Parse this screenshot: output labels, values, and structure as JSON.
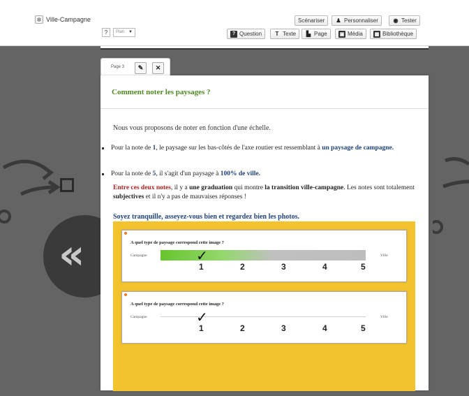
{
  "toolbar": {
    "project_name": "Ville-Campagne",
    "help_label": "?",
    "select_value": "Plan",
    "buttons_top": [
      "Scénariser",
      "Personnaliser",
      "Tester"
    ],
    "buttons_bottom": [
      "Question",
      "Texte",
      "Page",
      "Média",
      "Bibliothèque"
    ]
  },
  "tab": {
    "label": "Page 3",
    "edit_icon": "pencil-icon",
    "close_icon": "close-icon"
  },
  "page": {
    "title": "Comment noter les paysages ?",
    "intro": "Nous vous proposons de noter en fonction d'une échelle.",
    "bullet1_a": "Pour la note de ",
    "bullet1_num": "1",
    "bullet1_b": ", le paysage sur les bas-côtés de l'axe routier est ressemblant à ",
    "bullet1_c": "un paysage de campagne.",
    "bullet2_a": "Pour la note de ",
    "bullet2_num": "5",
    "bullet2_b": ", il s'agit d'un paysage à ",
    "bullet2_c": "100% de ville.",
    "para_a": "Entre ces deux notes",
    "para_b": ", il y a ",
    "para_c": "une graduation",
    "para_d": " qui montre ",
    "para_e": "la transition ville-campagne",
    "para_f": ". Les notes sont totalement ",
    "para_g": "subjectives",
    "para_h": " et il n'y a pas de mauvaises réponses !",
    "calm": "Soyez tranquille, asseyez-vous bien et regardez bien les photos."
  },
  "example_cards": [
    {
      "question": "A quel type de paysage correspond cette image ?",
      "left_label": "Campagne",
      "right_label": "Ville",
      "scale": [
        "1",
        "2",
        "3",
        "4",
        "5"
      ],
      "checkmark": "✓",
      "fill_value": 1,
      "selected": 1
    },
    {
      "question": "A quel type de paysage correspond cette image ?",
      "left_label": "Campagne",
      "right_label": "Ville",
      "scale": [
        "1",
        "2",
        "3",
        "4",
        "5"
      ],
      "checkmark": "✓",
      "fill_value": 0,
      "selected": 1
    }
  ],
  "colors": {
    "title_green": "#4d8a20",
    "accent_blue": "#20427a",
    "accent_red": "#b42020",
    "frame_yellow": "#f2c32c"
  },
  "background_icons": [
    "rewind-icon",
    "square-icon",
    "arrow-icon"
  ]
}
